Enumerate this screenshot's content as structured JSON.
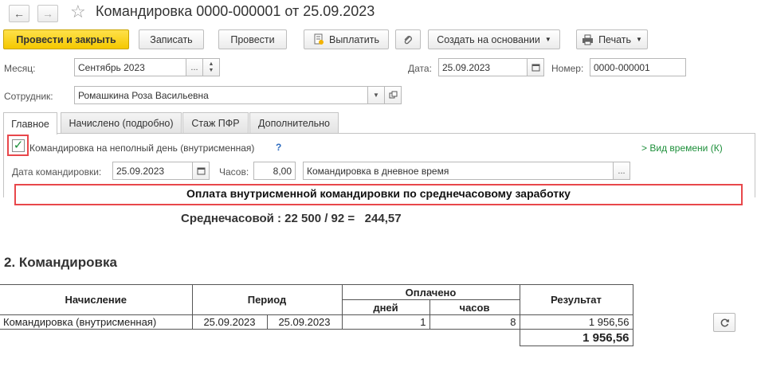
{
  "header": {
    "title": "Командировка 0000-000001 от 25.09.2023",
    "nav_back": "←",
    "nav_forward": "→",
    "star": "☆"
  },
  "toolbar": {
    "post_close": "Провести и закрыть",
    "save": "Записать",
    "post": "Провести",
    "pay": "Выплатить",
    "create_based": "Создать на основании",
    "print": "Печать"
  },
  "form": {
    "month_label": "Месяц:",
    "month_value": "Сентябрь 2023",
    "date_label": "Дата:",
    "date_value": "25.09.2023",
    "number_label": "Номер:",
    "number_value": "0000-000001",
    "employee_label": "Сотрудник:",
    "employee_value": "Ромашкина Роза Васильевна"
  },
  "tabs": [
    {
      "label": "Главное"
    },
    {
      "label": "Начислено (подробно)"
    },
    {
      "label": "Стаж ПФР"
    },
    {
      "label": "Дополнительно"
    }
  ],
  "main_tab": {
    "checkbox_label": "Командировка на неполный день (внутрисменная)",
    "help": "?",
    "time_view_link": "Вид времени (К)",
    "trip_date_label": "Дата командировки:",
    "trip_date_value": "25.09.2023",
    "hours_label": "Часов:",
    "hours_value": "8,00",
    "time_type_value": "Командировка в дневное время"
  },
  "report": {
    "banner": "Оплата внутрисменной командировки по среднечасовому заработку",
    "formula": "Среднечасовой : 22 500 / 92 =   244,57",
    "section_title": "2. Командировка",
    "headers": {
      "accrual": "Начисление",
      "period": "Период",
      "paid": "Оплачено",
      "days": "дней",
      "hours": "часов",
      "result": "Результат"
    },
    "row": {
      "accrual": "Командировка (внутрисменная)",
      "from": "25.09.2023",
      "to": "25.09.2023",
      "days": "1",
      "hours": "8",
      "result": "1 956,56"
    },
    "total": "1 956,56"
  },
  "colors": {
    "primary_button": "#f5c800",
    "highlight_border": "#e8474b",
    "link_green": "#1d8f3a"
  }
}
